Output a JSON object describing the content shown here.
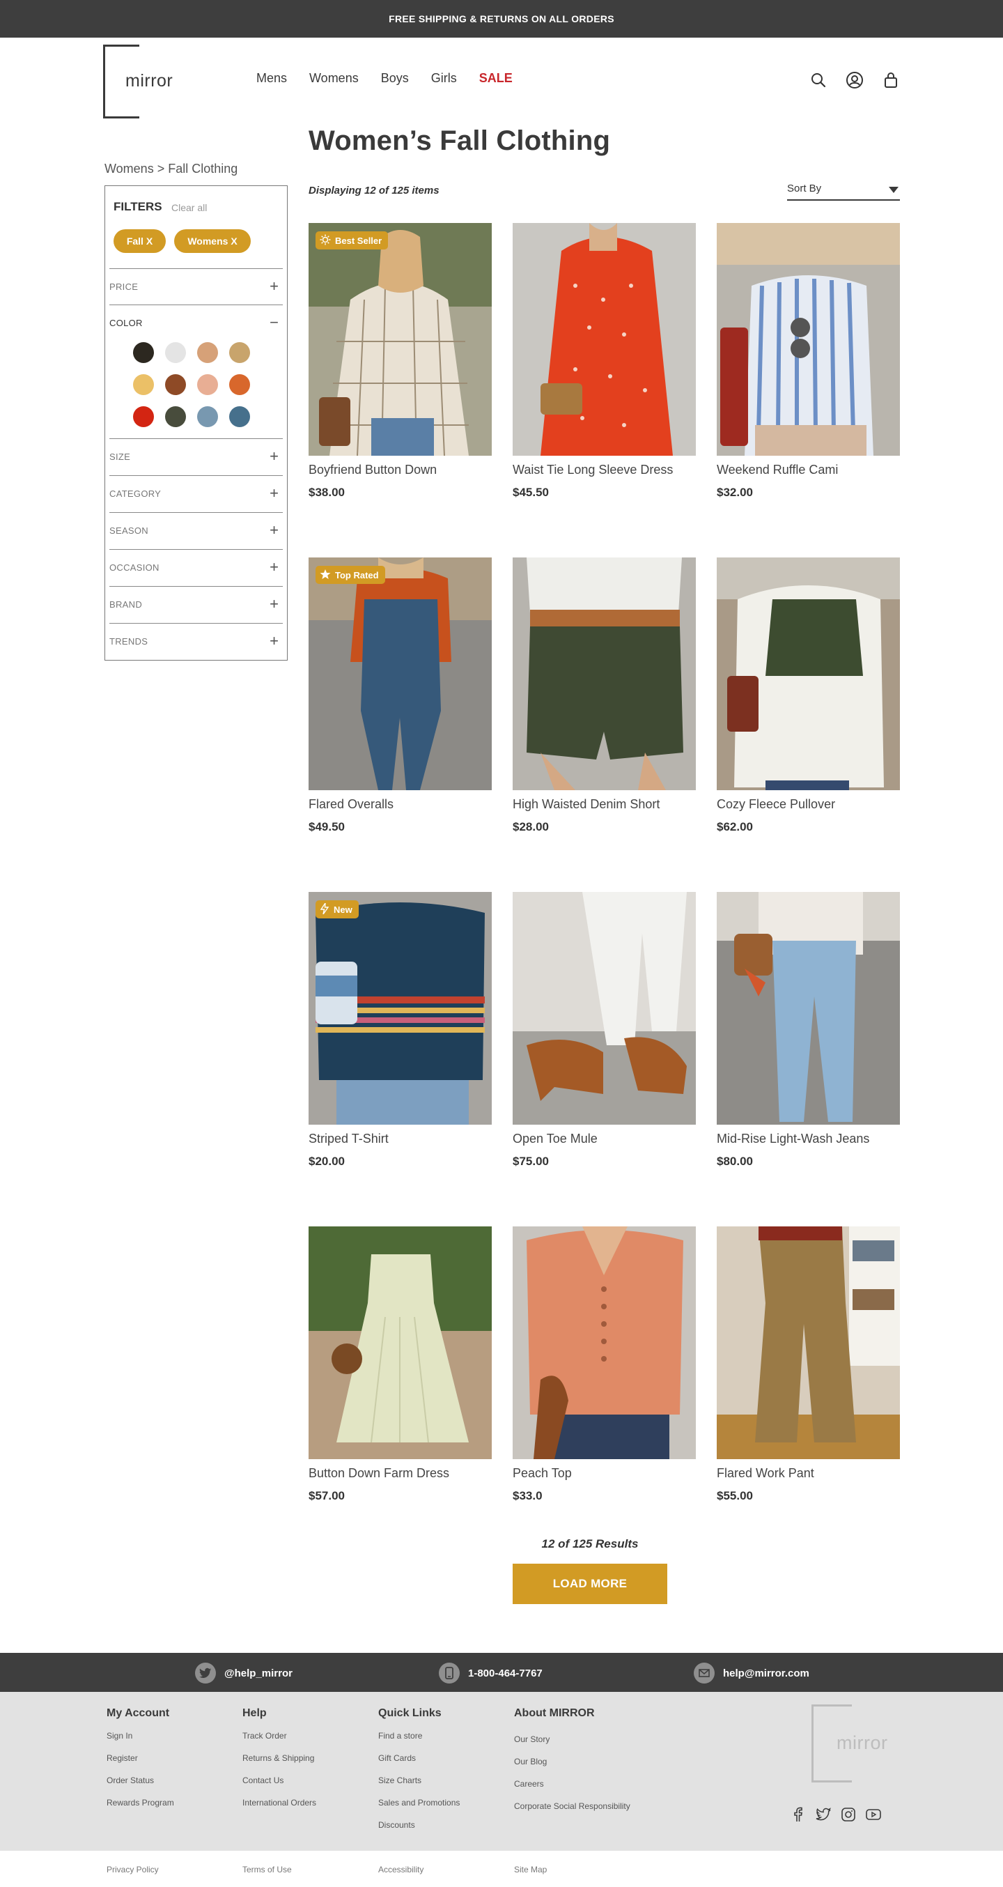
{
  "promo": {
    "text": "FREE SHIPPING & RETURNS ON ALL ORDERS"
  },
  "brand": {
    "name": "mirror",
    "accent": "#d29b24",
    "dark": "#3e3e3e",
    "sale_color": "#c8262b"
  },
  "nav": {
    "items": [
      "Mens",
      "Womens",
      "Boys",
      "Girls"
    ],
    "sale": "SALE"
  },
  "header_icons": [
    "search-icon",
    "account-icon",
    "shopping-bag-icon"
  ],
  "page": {
    "title": "Women’s Fall Clothing",
    "breadcrumb": "Womens > Fall Clothing",
    "displaying": "Displaying 12 of 125 items",
    "sort_label": "Sort By"
  },
  "filters": {
    "heading": "FILTERS",
    "clear_all": "Clear all",
    "chips": [
      "Fall  X",
      "Womens  X"
    ],
    "sections": {
      "price": "PRICE",
      "color": "COLOR",
      "size": "SIZE",
      "category": "CATEGORY",
      "season": "SEASON",
      "occasion": "OCCASION",
      "brand": "BRAND",
      "trends": "TRENDS"
    },
    "colors": [
      "#2c2820",
      "#e4e4e4",
      "#d6a178",
      "#c8a46c",
      "#ebc067",
      "#8e4a26",
      "#e8ae94",
      "#d8672c",
      "#d32512",
      "#484c3c",
      "#7898b0",
      "#46708c"
    ]
  },
  "products": [
    {
      "name": "Boyfriend Button Down",
      "price": "$38.00",
      "badge": "Best Seller",
      "badge_icon": "sun-icon"
    },
    {
      "name": "Waist Tie Long Sleeve Dress",
      "price": "$45.50"
    },
    {
      "name": "Weekend Ruffle Cami",
      "price": "$32.00"
    },
    {
      "name": "Flared Overalls",
      "price": "$49.50",
      "badge": "Top Rated",
      "badge_icon": "star-icon"
    },
    {
      "name": "High Waisted Denim Short",
      "price": "$28.00"
    },
    {
      "name": "Cozy Fleece Pullover",
      "price": "$62.00"
    },
    {
      "name": "Striped T-Shirt",
      "price": "$20.00",
      "badge": "New",
      "badge_icon": "lightning-icon"
    },
    {
      "name": "Open Toe Mule",
      "price": "$75.00"
    },
    {
      "name": "Mid-Rise Light-Wash Jeans",
      "price": "$80.00"
    },
    {
      "name": "Button Down Farm Dress",
      "price": "$57.00"
    },
    {
      "name": "Peach Top",
      "price": "$33.0"
    },
    {
      "name": "Flared Work Pant",
      "price": "$55.00"
    }
  ],
  "pagination": {
    "results": "12 of 125 Results",
    "load_more": "LOAD MORE"
  },
  "contact": {
    "twitter": "@help_mirror",
    "phone": "1-800-464-7767",
    "email": "help@mirror.com"
  },
  "footer": {
    "my_account": {
      "title": "My Account",
      "links": [
        "Sign In",
        "Register",
        "Order Status",
        "Rewards Program"
      ]
    },
    "help": {
      "title": "Help",
      "links": [
        "Track Order",
        "Returns & Shipping",
        "Contact Us",
        "International Orders"
      ]
    },
    "quick_links": {
      "title": "Quick Links",
      "links": [
        "Find a store",
        "Gift Cards",
        "Size Charts",
        "Sales and Promotions",
        "Discounts"
      ]
    },
    "about": {
      "title": "About MIRROR",
      "links": [
        "Our Story",
        "Our Blog",
        "Careers",
        "Corporate Social Responsibility"
      ]
    },
    "logo": "mirror",
    "social": [
      "facebook-icon",
      "twitter-icon",
      "instagram-icon",
      "youtube-icon"
    ]
  },
  "legal": {
    "privacy": "Privacy Policy",
    "terms": "Terms of Use",
    "accessibility": "Accessibility",
    "sitemap": "Site Map"
  }
}
